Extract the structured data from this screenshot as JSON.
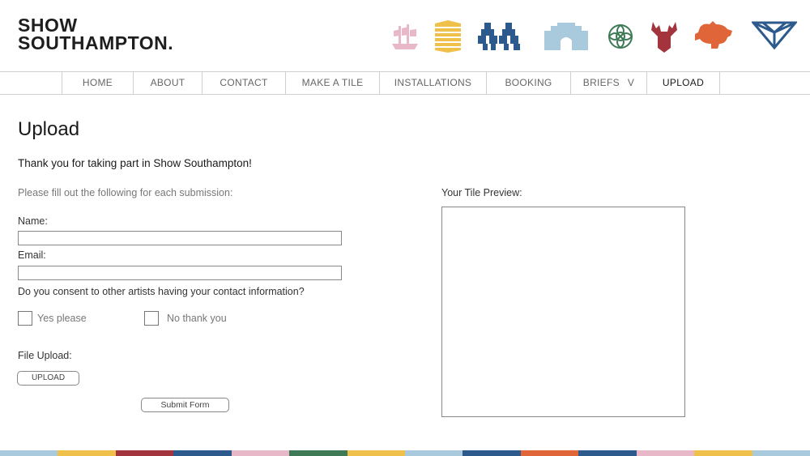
{
  "brand": {
    "line1": "SHOW",
    "line2": "SOUTHAMPTON."
  },
  "header_icons": [
    {
      "name": "ship-icon",
      "color": "#e8b8c8"
    },
    {
      "name": "stacked-bars-icon",
      "color": "#efc04a"
    },
    {
      "name": "figures-icon",
      "color": "#2d5a8c"
    },
    {
      "name": "bargate-icon",
      "color": "#a9c9dc"
    },
    {
      "name": "rose-icon",
      "color": "#3e7a56"
    },
    {
      "name": "stag-icon",
      "color": "#a3333c"
    },
    {
      "name": "turtle-icon",
      "color": "#e0663a"
    },
    {
      "name": "triangle-icon",
      "color": "#2d5a8c"
    }
  ],
  "nav": {
    "items": [
      {
        "label": "HOME"
      },
      {
        "label": "ABOUT"
      },
      {
        "label": "CONTACT"
      },
      {
        "label": "MAKE A TILE"
      },
      {
        "label": "INSTALLATIONS"
      },
      {
        "label": "BOOKING"
      },
      {
        "label": "BRIEFS",
        "caret": "V"
      },
      {
        "label": "UPLOAD",
        "active": true
      }
    ]
  },
  "page": {
    "title": "Upload",
    "thanks": "Thank you for taking part in Show Southampton!",
    "instructions": "Please fill out the following for each submission:"
  },
  "form": {
    "name_label": "Name:",
    "name_value": "",
    "email_label": "Email:",
    "email_value": "",
    "consent_question": "Do you consent to other artists having your contact information?",
    "consent_yes": "Yes please",
    "consent_no": "No thank you",
    "file_label": "File Upload:",
    "upload_button": "UPLOAD",
    "submit_button": "Submit Form"
  },
  "preview": {
    "label": "Your Tile Preview:"
  },
  "footer_colors": [
    "#a9c9dc",
    "#efc04a",
    "#a3333c",
    "#2d5a8c",
    "#e8b8c8",
    "#3e7a56",
    "#efc04a",
    "#a9c9dc",
    "#2d5a8c",
    "#e0663a",
    "#2d5a8c",
    "#e8b8c8",
    "#efc04a",
    "#a9c9dc"
  ]
}
